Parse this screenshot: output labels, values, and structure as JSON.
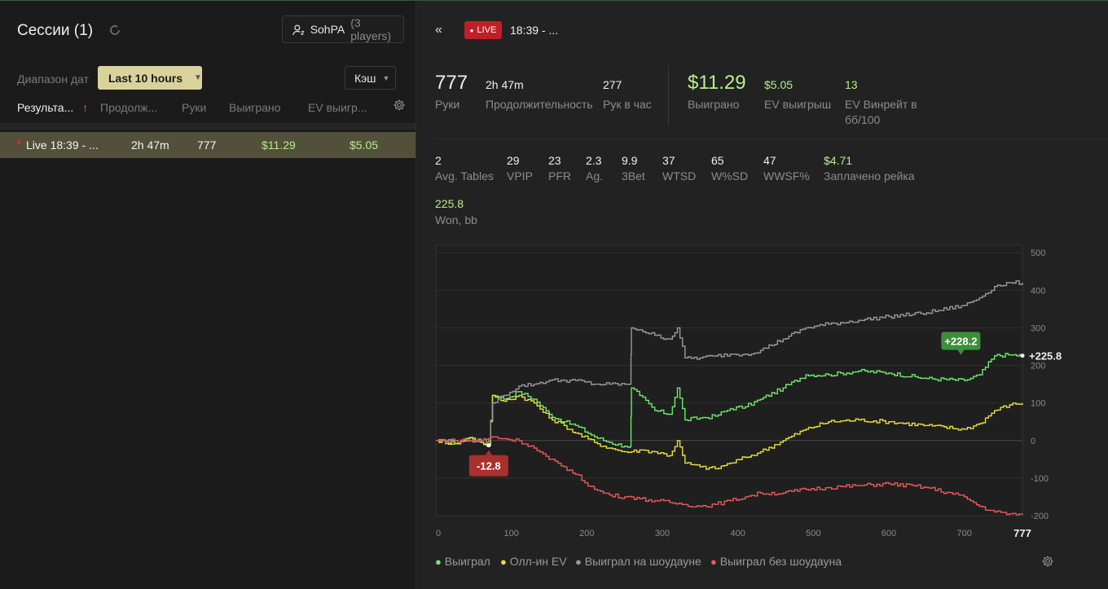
{
  "sessions": {
    "title": "Сессии (1)",
    "player_name": "SohPA",
    "player_count": "(3 players)",
    "date_range_label": "Диапазон дат",
    "date_range_value": "Last 10 hours",
    "game_type": "Кэш",
    "columns": [
      "Результа...",
      "Продолж...",
      "Руки",
      "Выиграно",
      "EV выигр..."
    ],
    "sort_arrow": "↑",
    "rows": [
      {
        "name": "Live 18:39 - ...",
        "duration": "2h 47m",
        "hands": "777",
        "won": "$11.29",
        "ev_won": "$5.05"
      }
    ]
  },
  "detail": {
    "back": "«",
    "live_badge": "LIVE",
    "title": "18:39 - ...",
    "main_stats": [
      {
        "value": "777",
        "label": "Руки"
      },
      {
        "value": "2h 47m",
        "label": "Продолжительность"
      },
      {
        "value": "277",
        "label": "Рук в час"
      },
      {
        "value": "$11.29",
        "label": "Выиграно"
      },
      {
        "value": "$5.05",
        "label": "EV выигрыш"
      },
      {
        "value": "13",
        "label": "EV Винрейт в",
        "label2": "бб/100"
      }
    ],
    "stats": [
      {
        "value": "2",
        "label": "Avg. Tables"
      },
      {
        "value": "29",
        "label": "VPIP"
      },
      {
        "value": "23",
        "label": "PFR"
      },
      {
        "value": "2.3",
        "label": "Ag."
      },
      {
        "value": "9.9",
        "label": "3Bet"
      },
      {
        "value": "37",
        "label": "WTSD"
      },
      {
        "value": "65",
        "label": "W%SD"
      },
      {
        "value": "47",
        "label": "WWSF%"
      },
      {
        "value": "$4.71",
        "label": "Заплачено рейка"
      }
    ],
    "won_bb": {
      "value": "225.8",
      "label": "Won, bb"
    }
  },
  "colors": {
    "won": "#6ee86a",
    "allin_ev": "#e8e03a",
    "showdown": "#9a9a9a",
    "non_showdown": "#e85a5a",
    "live": "#c01f26",
    "date_button": "#d9d39b",
    "selected_row": "#52503a"
  },
  "chart_data": {
    "type": "line",
    "x_ticks": [
      "0",
      "100",
      "200",
      "300",
      "400",
      "500",
      "600",
      "700"
    ],
    "x_end_label": "777",
    "y_ticks": [
      "500",
      "400",
      "300",
      "200",
      "100",
      "0",
      "-100",
      "-200"
    ],
    "xlim": [
      0,
      777
    ],
    "ylim": [
      -200,
      500
    ],
    "grid": true,
    "legend_position": "bottom",
    "annotations": {
      "max_label": "+228.2",
      "min_label": "-12.8",
      "end_label": "+225.8"
    },
    "series": [
      {
        "name": "Выиграл",
        "color": "#6ee86a",
        "points": [
          [
            0,
            0
          ],
          [
            25,
            -8
          ],
          [
            45,
            8
          ],
          [
            60,
            -5
          ],
          [
            70,
            -12.8
          ],
          [
            75,
            120
          ],
          [
            90,
            110
          ],
          [
            110,
            130
          ],
          [
            130,
            110
          ],
          [
            150,
            70
          ],
          [
            170,
            50
          ],
          [
            185,
            40
          ],
          [
            210,
            10
          ],
          [
            230,
            -5
          ],
          [
            250,
            -15
          ],
          [
            258,
            -15
          ],
          [
            259,
            140
          ],
          [
            270,
            120
          ],
          [
            290,
            80
          ],
          [
            310,
            70
          ],
          [
            320,
            140
          ],
          [
            330,
            55
          ],
          [
            350,
            60
          ],
          [
            370,
            65
          ],
          [
            390,
            85
          ],
          [
            410,
            90
          ],
          [
            430,
            110
          ],
          [
            460,
            140
          ],
          [
            490,
            175
          ],
          [
            520,
            175
          ],
          [
            560,
            185
          ],
          [
            600,
            180
          ],
          [
            650,
            165
          ],
          [
            700,
            160
          ],
          [
            720,
            175
          ],
          [
            740,
            225.8
          ],
          [
            758,
            228.2
          ],
          [
            777,
            225.8
          ]
        ]
      },
      {
        "name": "Олл-ин EV",
        "color": "#e8e03a",
        "points": [
          [
            0,
            0
          ],
          [
            25,
            -8
          ],
          [
            45,
            8
          ],
          [
            60,
            -5
          ],
          [
            70,
            -12.8
          ],
          [
            75,
            120
          ],
          [
            90,
            105
          ],
          [
            110,
            120
          ],
          [
            130,
            100
          ],
          [
            150,
            60
          ],
          [
            170,
            40
          ],
          [
            185,
            20
          ],
          [
            210,
            -5
          ],
          [
            230,
            -20
          ],
          [
            250,
            -30
          ],
          [
            259,
            -30
          ],
          [
            270,
            -25
          ],
          [
            290,
            -30
          ],
          [
            310,
            -40
          ],
          [
            320,
            0
          ],
          [
            330,
            -60
          ],
          [
            350,
            -70
          ],
          [
            370,
            -75
          ],
          [
            390,
            -60
          ],
          [
            410,
            -45
          ],
          [
            430,
            -30
          ],
          [
            460,
            0
          ],
          [
            490,
            30
          ],
          [
            520,
            50
          ],
          [
            560,
            55
          ],
          [
            600,
            50
          ],
          [
            650,
            40
          ],
          [
            700,
            30
          ],
          [
            720,
            45
          ],
          [
            740,
            80
          ],
          [
            760,
            95
          ],
          [
            777,
            100
          ]
        ]
      },
      {
        "name": "Выиграл на шоудауне",
        "color": "#9a9a9a",
        "points": [
          [
            0,
            0
          ],
          [
            25,
            0
          ],
          [
            45,
            0
          ],
          [
            60,
            0
          ],
          [
            70,
            0
          ],
          [
            75,
            100
          ],
          [
            90,
            120
          ],
          [
            110,
            145
          ],
          [
            130,
            150
          ],
          [
            150,
            160
          ],
          [
            170,
            160
          ],
          [
            185,
            160
          ],
          [
            210,
            150
          ],
          [
            230,
            150
          ],
          [
            250,
            150
          ],
          [
            258,
            150
          ],
          [
            259,
            300
          ],
          [
            270,
            295
          ],
          [
            290,
            280
          ],
          [
            310,
            270
          ],
          [
            320,
            300
          ],
          [
            330,
            220
          ],
          [
            350,
            220
          ],
          [
            370,
            225
          ],
          [
            390,
            230
          ],
          [
            410,
            230
          ],
          [
            430,
            240
          ],
          [
            460,
            270
          ],
          [
            490,
            300
          ],
          [
            520,
            310
          ],
          [
            560,
            320
          ],
          [
            600,
            330
          ],
          [
            650,
            340
          ],
          [
            700,
            360
          ],
          [
            720,
            380
          ],
          [
            740,
            410
          ],
          [
            760,
            420
          ],
          [
            777,
            420
          ]
        ]
      },
      {
        "name": "Выиграл без шоудауна",
        "color": "#e85a5a",
        "points": [
          [
            0,
            0
          ],
          [
            25,
            0
          ],
          [
            45,
            0
          ],
          [
            60,
            0
          ],
          [
            70,
            5
          ],
          [
            75,
            10
          ],
          [
            90,
            5
          ],
          [
            110,
            0
          ],
          [
            130,
            -20
          ],
          [
            150,
            -50
          ],
          [
            170,
            -70
          ],
          [
            185,
            -90
          ],
          [
            210,
            -130
          ],
          [
            230,
            -145
          ],
          [
            250,
            -150
          ],
          [
            259,
            -150
          ],
          [
            270,
            -155
          ],
          [
            290,
            -160
          ],
          [
            310,
            -165
          ],
          [
            330,
            -170
          ],
          [
            350,
            -175
          ],
          [
            370,
            -170
          ],
          [
            390,
            -160
          ],
          [
            410,
            -150
          ],
          [
            430,
            -140
          ],
          [
            460,
            -140
          ],
          [
            490,
            -130
          ],
          [
            520,
            -125
          ],
          [
            560,
            -120
          ],
          [
            600,
            -115
          ],
          [
            650,
            -125
          ],
          [
            700,
            -150
          ],
          [
            720,
            -175
          ],
          [
            740,
            -190
          ],
          [
            760,
            -195
          ],
          [
            777,
            -198
          ]
        ]
      }
    ]
  }
}
